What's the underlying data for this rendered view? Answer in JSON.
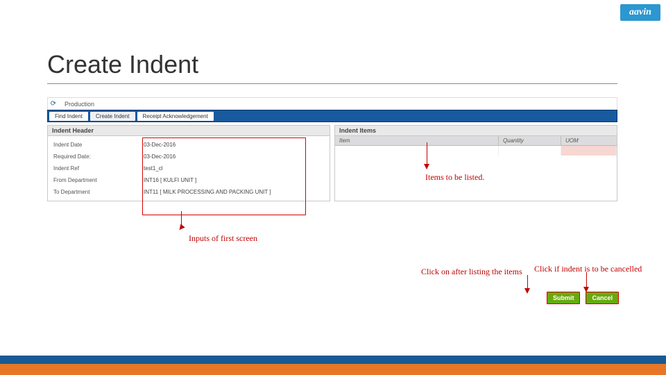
{
  "brand": {
    "logo_text": "aavin"
  },
  "page": {
    "title": "Create Indent"
  },
  "breadcrumb": {
    "section": "Production"
  },
  "tabs": {
    "find": "Find Indent",
    "create": "Create Indent",
    "receipt": "Receipt Acknowledgement"
  },
  "header_panel": {
    "title": "Indent Header",
    "rows": {
      "indent_date": {
        "label": "Indent Date",
        "value": "03-Dec-2016"
      },
      "required_date": {
        "label": "Required Date:",
        "value": "03-Dec-2016"
      },
      "indent_ref": {
        "label": "Indent Ref",
        "value": "test1_cl"
      },
      "from_dept": {
        "label": "From Department",
        "value": "INT16 [ KULFI UNIT ]"
      },
      "to_dept": {
        "label": "To Department",
        "value": "INT11 [ MILK PROCESSING AND PACKING UNIT ]"
      }
    }
  },
  "items_panel": {
    "title": "Indent Items",
    "columns": {
      "item": "Item",
      "qty": "Quantity",
      "uom": "UOM"
    }
  },
  "buttons": {
    "submit": "Submit",
    "cancel": "Cancel"
  },
  "annotations": {
    "inputs": "Inputs of first screen",
    "items": "Items to be listed.",
    "submit_note": "Click on after listing the items",
    "cancel_note": "Click if indent is to be cancelled"
  }
}
